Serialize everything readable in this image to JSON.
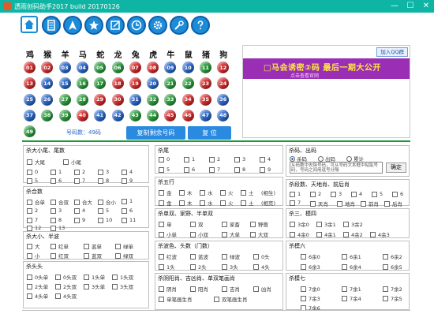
{
  "window": {
    "title": "透雨创码助手2017 build 20170126",
    "minimize": "—",
    "maximize": "☐",
    "close": "✕"
  },
  "toolbar": [
    {
      "icon": "home-icon"
    },
    {
      "icon": "calculator-icon"
    },
    {
      "icon": "navigation-icon"
    },
    {
      "icon": "star-icon"
    },
    {
      "icon": "edit-icon"
    },
    {
      "icon": "clock-icon"
    },
    {
      "icon": "gear-icon"
    },
    {
      "icon": "wrench-icon"
    },
    {
      "icon": "help-icon"
    }
  ],
  "zodiacs": [
    "鸡",
    "猴",
    "羊",
    "马",
    "蛇",
    "龙",
    "兔",
    "虎",
    "牛",
    "鼠",
    "猪",
    "狗"
  ],
  "balls": [
    {
      "n": "01",
      "c": "red"
    },
    {
      "n": "02",
      "c": "red"
    },
    {
      "n": "03",
      "c": "blue"
    },
    {
      "n": "04",
      "c": "blue"
    },
    {
      "n": "05",
      "c": "green"
    },
    {
      "n": "06",
      "c": "green"
    },
    {
      "n": "07",
      "c": "red"
    },
    {
      "n": "08",
      "c": "red"
    },
    {
      "n": "09",
      "c": "blue"
    },
    {
      "n": "10",
      "c": "blue"
    },
    {
      "n": "11",
      "c": "green"
    },
    {
      "n": "12",
      "c": "red"
    },
    {
      "n": "13",
      "c": "red"
    },
    {
      "n": "14",
      "c": "blue"
    },
    {
      "n": "15",
      "c": "blue"
    },
    {
      "n": "16",
      "c": "green"
    },
    {
      "n": "17",
      "c": "green"
    },
    {
      "n": "18",
      "c": "red"
    },
    {
      "n": "19",
      "c": "red"
    },
    {
      "n": "20",
      "c": "blue"
    },
    {
      "n": "21",
      "c": "green"
    },
    {
      "n": "22",
      "c": "green"
    },
    {
      "n": "23",
      "c": "red"
    },
    {
      "n": "24",
      "c": "red"
    },
    {
      "n": "25",
      "c": "blue"
    },
    {
      "n": "26",
      "c": "blue"
    },
    {
      "n": "27",
      "c": "green"
    },
    {
      "n": "28",
      "c": "green"
    },
    {
      "n": "29",
      "c": "red"
    },
    {
      "n": "30",
      "c": "red"
    },
    {
      "n": "31",
      "c": "blue"
    },
    {
      "n": "32",
      "c": "green"
    },
    {
      "n": "33",
      "c": "green"
    },
    {
      "n": "34",
      "c": "red"
    },
    {
      "n": "35",
      "c": "red"
    },
    {
      "n": "36",
      "c": "blue"
    },
    {
      "n": "37",
      "c": "blue"
    },
    {
      "n": "38",
      "c": "green"
    },
    {
      "n": "39",
      "c": "green"
    },
    {
      "n": "40",
      "c": "red"
    },
    {
      "n": "41",
      "c": "blue"
    },
    {
      "n": "42",
      "c": "blue"
    },
    {
      "n": "43",
      "c": "green"
    },
    {
      "n": "44",
      "c": "green"
    },
    {
      "n": "45",
      "c": "red"
    },
    {
      "n": "46",
      "c": "red"
    },
    {
      "n": "47",
      "c": "blue"
    },
    {
      "n": "48",
      "c": "blue"
    },
    {
      "n": "49",
      "c": "green"
    }
  ],
  "count_label": "号码数：49码",
  "copy_button": "复制剩余号码",
  "reset_button": "复  位",
  "banner": {
    "qq_button": "加入QQ群",
    "headline": "□马会诱密②码 最后一期大公开",
    "subline": "点击查看官网"
  },
  "groups": [
    {
      "title": "杀大小尾、尾数",
      "items": [
        "大尾",
        "小尾",
        "0",
        "1",
        "2",
        "3",
        "4",
        "5",
        "6",
        "7",
        "8",
        "9"
      ]
    },
    {
      "title": "杀合数",
      "items": [
        "合单",
        "合双",
        "合大",
        "合小",
        "1",
        "2",
        "3",
        "4",
        "5",
        "6",
        "7",
        "8",
        "9",
        "10",
        "11",
        "12",
        "13"
      ]
    },
    {
      "title": "杀大小、半波",
      "items": [
        "大",
        "红单",
        "蓝单",
        "绿单",
        "小",
        "红双",
        "蓝双",
        "绿双"
      ]
    },
    {
      "title": "杀头头",
      "items": [
        "0头单",
        "0头双",
        "1头单",
        "1头双",
        "2头单",
        "2头双",
        "3头单",
        "3头双",
        "4头单",
        "4头双"
      ]
    },
    {
      "title": "杀尾",
      "items": [
        "0",
        "1",
        "2",
        "3",
        "4",
        "5",
        "6",
        "7",
        "8",
        "9"
      ]
    },
    {
      "title": "杀五行",
      "items": [
        "金",
        "木",
        "水",
        "火",
        "土",
        "(相生)",
        "金",
        "木",
        "水",
        "火",
        "土",
        "(相克)"
      ]
    },
    {
      "title": "杀单双、家野、半单双",
      "items": [
        "单",
        "双",
        "家畜",
        "野兽",
        "小单",
        "小双",
        "大单",
        "大双"
      ]
    },
    {
      "title": "杀波色、头数（门数）",
      "items": [
        "红波",
        "蓝波",
        "绿波",
        "0头",
        "1头",
        "2头",
        "3头",
        "4头"
      ]
    },
    {
      "title": "杀阴阳肖、吉凶肖、单双笔画肖",
      "items": [
        "阴肖",
        "阳肖",
        "吉肖",
        "凶肖",
        "单笔画生肖",
        "双笔画生肖"
      ]
    },
    {
      "title": "杀码、出码",
      "radios": [
        "杀码",
        "出码",
        "累计"
      ],
      "note": "从码数中去除号码，可从号码文本框中粘贴号码，号码之间用逗号分隔",
      "ok": "确定"
    },
    {
      "title": "杀段数、天地肖、前后肖",
      "items": [
        "1",
        "2",
        "3",
        "4",
        "5",
        "6",
        "7",
        "天肖",
        "地肖",
        "前肖",
        "后肖"
      ]
    },
    {
      "title": "杀三、模四",
      "items": [
        "3余0",
        "3余1",
        "3余2",
        "4余0",
        "4余1",
        "4余2",
        "4余3"
      ]
    },
    {
      "title": "杀模六",
      "items": [
        "6余0",
        "6余1",
        "6余2",
        "6余3",
        "6余4",
        "6余5"
      ]
    },
    {
      "title": "杀模七",
      "items": [
        "7余0",
        "7余1",
        "7余2",
        "7余3",
        "7余4",
        "7余5",
        "7余6"
      ]
    }
  ]
}
